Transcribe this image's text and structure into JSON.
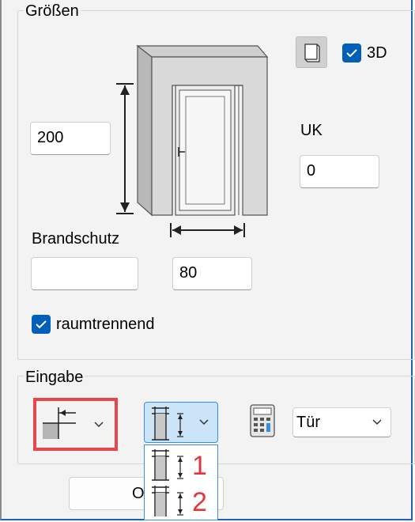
{
  "groups": {
    "sizes_title": "Größen",
    "input_title": "Eingabe"
  },
  "sizes": {
    "height_value": "200",
    "uk_label": "UK",
    "uk_value": "0",
    "fire_label": "Brandschutz",
    "fire_value": "",
    "width_value": "80",
    "toggle_3d_label": "3D",
    "toggle_3d_checked": true,
    "room_separating_label": "raumtrennend",
    "room_separating_checked": true
  },
  "input": {
    "mode_combo_icon": "reference-point-icon",
    "dimension_combo_icon": "door-dimension-icon",
    "calculator_icon": "calculator-icon",
    "type_combo_value": "Tür",
    "dropdown_items": [
      {
        "icon": "door-dimension-icon",
        "label": "1"
      },
      {
        "icon": "door-dimension-icon",
        "label": "2"
      }
    ]
  },
  "footer": {
    "ok_button_label": "OK"
  },
  "colors": {
    "accent": "#005fb8",
    "highlight": "#e8464a",
    "dropdown_number": "#e0373d"
  }
}
